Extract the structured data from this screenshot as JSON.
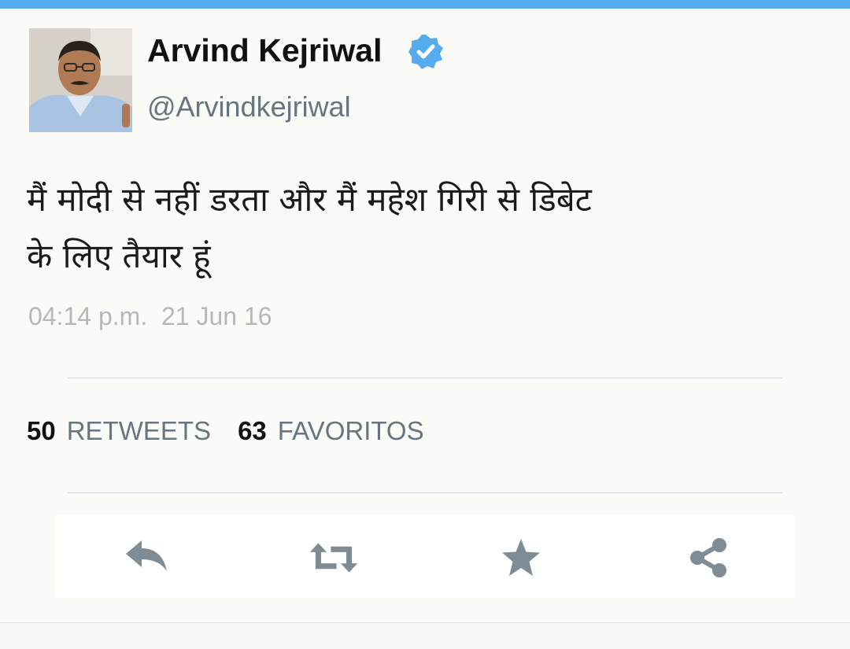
{
  "tweet": {
    "author": {
      "display_name": "Arvind Kejriwal",
      "handle": "@Arvindkejriwal",
      "verified": true
    },
    "text_lines": [
      "मैं मोदी से नहीं डरता और मैं महेश गिरी से डिबेट",
      "के लिए तैयार हूं"
    ],
    "timestamp": "04:14 p.m.  21 Jun 16",
    "stats": {
      "retweets_count": "50",
      "retweets_label": "RETWEETS",
      "favorites_count": "63",
      "favorites_label": "FAVORITOS"
    }
  },
  "actions": [
    {
      "name": "reply-icon"
    },
    {
      "name": "retweet-icon"
    },
    {
      "name": "star-icon"
    },
    {
      "name": "share-icon"
    }
  ],
  "colors": {
    "accent": "#55acee",
    "icon": "#7f8c95",
    "muted": "#66757f",
    "timestamp": "#b3b8bc"
  }
}
